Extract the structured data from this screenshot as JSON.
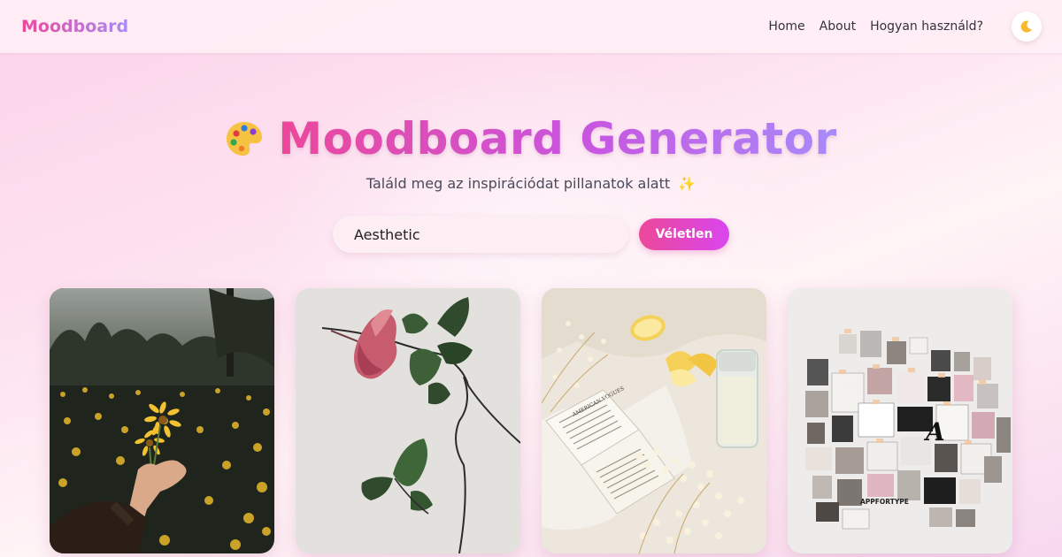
{
  "app": {
    "logo": "Moodboard"
  },
  "nav": {
    "links": [
      {
        "label": "Home"
      },
      {
        "label": "About"
      },
      {
        "label": "Hogyan használd?"
      }
    ],
    "theme_toggle_icon": "moon-icon"
  },
  "hero": {
    "icon": "palette-icon",
    "title": "Moodboard Generator",
    "subtitle": "Találd meg az inspirációdat pillanatok alatt",
    "subtitle_icon": "✨"
  },
  "search": {
    "value": "Aesthetic",
    "button_label": "Véletlen"
  },
  "gallery": {
    "images": [
      {
        "name": "yellow-daisies-field-photo",
        "collage_text": []
      },
      {
        "name": "hibiscus-flower-photo",
        "collage_text": []
      },
      {
        "name": "book-lemons-flowers-photo",
        "collage_text": [
          "AMERICAN VOGUES"
        ]
      },
      {
        "name": "wall-collage-photo",
        "collage_text": [
          "APPFORTYPE",
          "A"
        ]
      }
    ]
  },
  "colors": {
    "accent_pink": "#ec4899",
    "accent_violet": "#a78bfa",
    "button_gradient_end": "#d946ef"
  }
}
